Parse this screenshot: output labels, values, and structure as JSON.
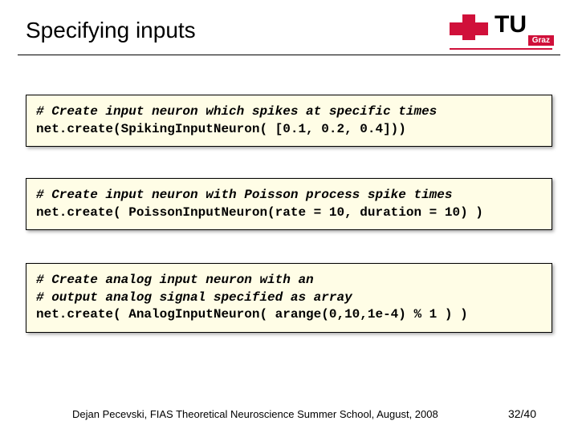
{
  "header": {
    "title": "Specifying inputs",
    "logo_text": "TU",
    "logo_sub": "Graz"
  },
  "boxes": [
    {
      "comment_lines": [
        "# Create input neuron which spikes at specific times"
      ],
      "code_lines": [
        "net.create(SpikingInputNeuron( [0.1, 0.2, 0.4]))"
      ]
    },
    {
      "comment_lines": [
        "# Create input neuron with Poisson process spike times"
      ],
      "code_lines": [
        "net.create( PoissonInputNeuron(rate = 10, duration = 10) )"
      ]
    },
    {
      "comment_lines": [
        "# Create analog input neuron with an",
        "# output analog signal specified as array"
      ],
      "code_lines": [
        "net.create( AnalogInputNeuron( arange(0,10,1e-4) % 1 ) )"
      ]
    }
  ],
  "footer": {
    "credit": "Dejan Pecevski, FIAS Theoretical Neuroscience Summer School, August, 2008",
    "page": "32/40"
  }
}
